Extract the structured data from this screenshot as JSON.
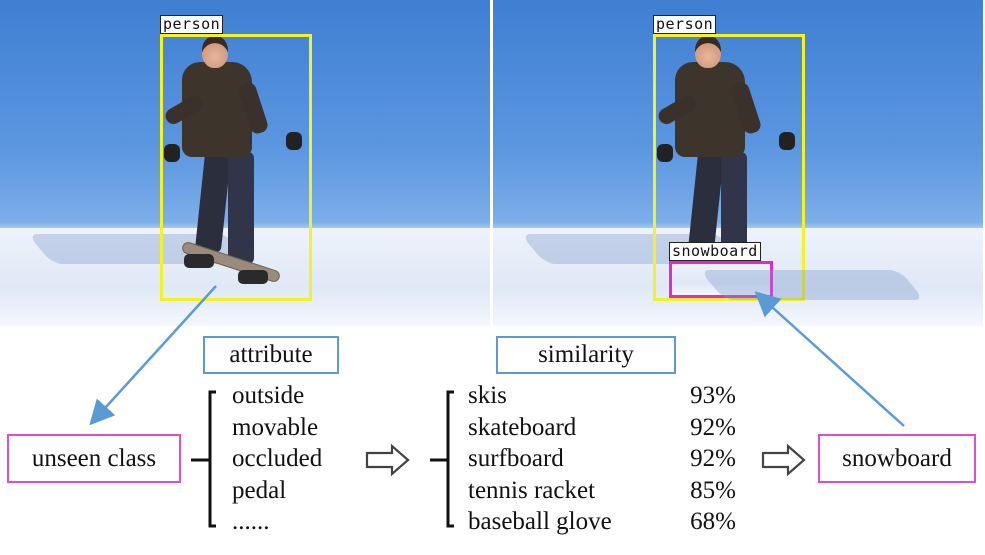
{
  "figure": {
    "left_panel": {
      "detections": [
        {
          "label": "person",
          "color": "#f2f226"
        }
      ]
    },
    "right_panel": {
      "detections": [
        {
          "label": "person",
          "color": "#f2f226"
        },
        {
          "label": "snowboard",
          "color": "#e528c8"
        }
      ]
    },
    "unseen_box": {
      "label": "unseen class"
    },
    "attribute_box": {
      "label": "attribute"
    },
    "attributes": [
      "outside",
      "movable",
      "occluded",
      "pedal",
      "......"
    ],
    "similarity_box": {
      "label": "similarity"
    },
    "similarities": [
      {
        "name": "skis",
        "value": "93%"
      },
      {
        "name": "skateboard",
        "value": "92%"
      },
      {
        "name": "surfboard",
        "value": "92%"
      },
      {
        "name": "tennis racket",
        "value": "85%"
      },
      {
        "name": "baseball glove",
        "value": "68%"
      }
    ],
    "result_box": {
      "label": "snowboard"
    },
    "colors": {
      "arrow_blue": "#5b9bd5",
      "box_pink": "#e04ecc",
      "bbox_yellow": "#f2f226",
      "bbox_magenta": "#e528c8"
    }
  }
}
